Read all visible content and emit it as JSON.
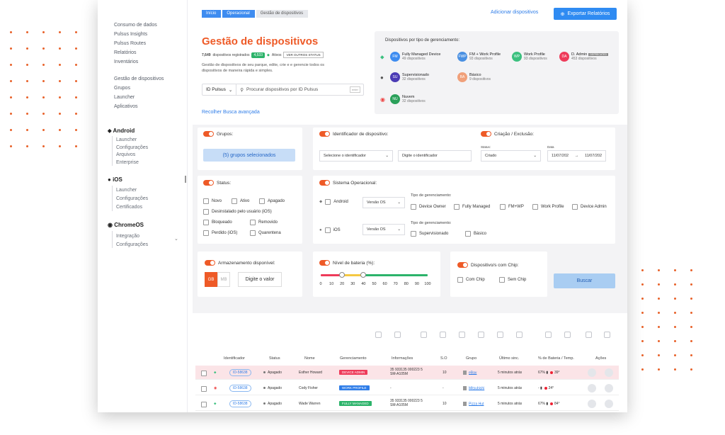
{
  "sidebar": {
    "items_top": [
      "Consumo de dados",
      "Pulsus Insights",
      "Pulsus Routes",
      "Relatórios",
      "Inventários"
    ],
    "items_mid": [
      "Gestão de dispositivos",
      "Grupos",
      "Launcher",
      "Aplicativos"
    ],
    "android": {
      "title": "Android",
      "items": [
        "Launcher",
        "Configurações",
        "Arquivos",
        "Enterprise"
      ]
    },
    "ios": {
      "title": "iOS",
      "items": [
        "Launcher",
        "Configurações",
        "Certificados"
      ]
    },
    "chromeos": {
      "title": "ChromeOS",
      "items": [
        "Integração",
        "Configurações"
      ]
    }
  },
  "breadcrumb": [
    "Início",
    "Operacional",
    "Gestão de dispositivos"
  ],
  "header": {
    "add_label": "Adicionar dispositivos",
    "export_label": "Exportar Relatórios",
    "title": "Gestão de dispositivos",
    "count": "7,649",
    "count_text": "dispositivos registrados",
    "active_count": "4,533",
    "active_label": "Ativos",
    "see_all": "VER OUTROS STATUS",
    "description": "Gestão de dispositivos de seu parque, edite, crie e e gerencie todos os dispositivos de maneira rápida e simples.",
    "id_select": "ID Pulsus",
    "search_placeholder": "Procurar dispositivos por ID Pulsus",
    "enter_key": "enter",
    "collapse_link": "Recolher Busca avançada"
  },
  "management": {
    "title": "Dispositivos por tipo de gerenciamento:",
    "types": [
      {
        "abbr": "FM",
        "name": "Fully Managed Device",
        "count": "49 dispositivos",
        "color": "#3e8cf0"
      },
      {
        "abbr": "FWP",
        "name": "FM + Work Profile",
        "count": "93 dispositivos",
        "color": "#4a90e2"
      },
      {
        "abbr": "WP",
        "name": "Work Profile",
        "count": "93 dispositivos",
        "color": "#3cc07f"
      },
      {
        "abbr": "DA",
        "name": "D. Admin",
        "count": "453 dispositivos",
        "color": "#ee3b5a",
        "tag": "DEPRECATED"
      },
      {
        "abbr": "SU",
        "name": "Supervisionado",
        "count": "32 dispositivos",
        "color": "#4b3bb5"
      },
      {
        "abbr": "BA",
        "name": "Básico",
        "count": "9 dispositivos",
        "color": "#f0a07a"
      },
      {
        "abbr": "NU",
        "name": "Nuvem",
        "count": "32 dispositivos",
        "color": "#2aa05a"
      }
    ]
  },
  "filters": {
    "groups": {
      "label": "Grupos:",
      "selected": "(5) grupos selecionados"
    },
    "identifier": {
      "label": "Identificador de dispositivo:",
      "select": "Selecione o identificador",
      "input_placeholder": "Digite o identificador"
    },
    "creation": {
      "label": "Criação / Exclusão:",
      "status_label": "Status:",
      "status_value": "Criado",
      "date_label": "Data",
      "date_from": "11/07/202",
      "date_to": "11/07/202"
    },
    "status": {
      "label": "Status:",
      "options": [
        "Novo",
        "Ativo",
        "Apagado",
        "Desinstalado pelo usuário (iOS)",
        "Bloqueado",
        "Removido",
        "Perdido (iOS)",
        "Quarentena"
      ]
    },
    "os": {
      "label": "Sistema Operacional:",
      "android": "Android",
      "ios": "iOS",
      "version_label": "Versão OS",
      "mgmt_label": "Tipo de gerenciamento:",
      "android_types": [
        "Device Owner",
        "Fully Managed",
        "FM+WP",
        "Work Profile",
        "Device Admin"
      ],
      "ios_types": [
        "Supervisionado",
        "Básico"
      ]
    },
    "storage": {
      "label": "Armazenamento disponível:",
      "unit_gb": "GB",
      "unit_mb": "MB",
      "value_placeholder": "Digite o valor"
    },
    "battery": {
      "label": "Nível de bateria (%):",
      "ticks": [
        "0",
        "10",
        "20",
        "30",
        "40",
        "50",
        "60",
        "70",
        "80",
        "90",
        "100"
      ],
      "range": [
        20,
        40
      ]
    },
    "chip": {
      "label": "Dispositivo/s com Chip:",
      "options": [
        "Com Chip",
        "Sem Chip"
      ]
    },
    "search_button": "Buscar"
  },
  "table": {
    "headers": [
      "Identificador",
      "Status",
      "Nome",
      "Gerenciamento",
      "Informações",
      "S.O",
      "Grupo",
      "Último sinc.",
      "% de Bateria / Temp.",
      "Ações"
    ],
    "rows": [
      {
        "id": "ID-58638",
        "status": "Apagado",
        "name": "Esther Howard",
        "mgmt": "DEVICE ADMIN",
        "mgmt_color": "#ee3b5a",
        "info1": "35 933135 000223 5",
        "info2": "SM-A105M",
        "so": "10",
        "group": "eBay",
        "sync": "5 minutos atrás",
        "battery": "67%",
        "temp": "39°",
        "os": "android",
        "highlight": true
      },
      {
        "id": "ID-58638",
        "status": "Apagado",
        "name": "Cody Fisher",
        "mgmt": "WORK PROFILE",
        "mgmt_color": "#2f7de8",
        "info1": "-",
        "info2": "",
        "so": "-",
        "group": "Mitsubishi",
        "sync": "5 minutos atrás",
        "battery": "-",
        "temp": "24°",
        "os": "chrome",
        "highlight": false
      },
      {
        "id": "ID-58638",
        "status": "Apagado",
        "name": "Wade Warren",
        "mgmt": "FULLY MANAGED",
        "mgmt_color": "#2cb36a",
        "info1": "35 933135 000223 5",
        "info2": "SM-A105M",
        "so": "10",
        "group": "Pizza Hut",
        "sync": "5 minutos atrás",
        "battery": "67%",
        "temp": "84°",
        "os": "android",
        "highlight": false
      }
    ]
  }
}
